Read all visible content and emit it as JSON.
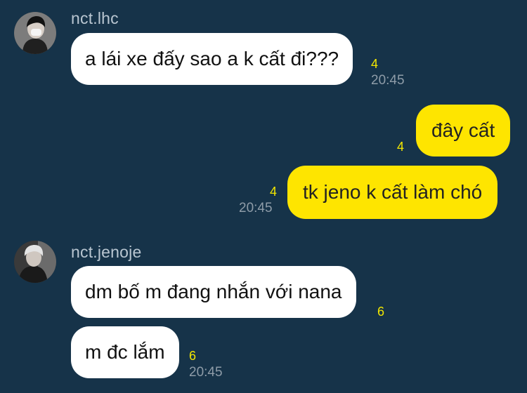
{
  "theme": {
    "background": "#163349",
    "incoming_bubble": "#ffffff",
    "outgoing_bubble": "#fee500",
    "unread_color": "#f2e600",
    "time_color": "#8e9ca8"
  },
  "messages": [
    {
      "sender": "nct.lhc",
      "avatar_icon": "user-avatar-masked-icon",
      "text": "a lái xe đấy sao a k cất đi???",
      "unread": "4",
      "time": "20:45"
    },
    {
      "text": "đây cất",
      "unread": "4"
    },
    {
      "text": "tk jeno k cất làm chó",
      "unread": "4",
      "time": "20:45"
    },
    {
      "sender": "nct.jenoje",
      "avatar_icon": "user-avatar-icon",
      "text": "dm bố m đang nhắn với nana",
      "unread": "6"
    },
    {
      "text": "m đc lắm",
      "unread": "6",
      "time": "20:45"
    }
  ]
}
